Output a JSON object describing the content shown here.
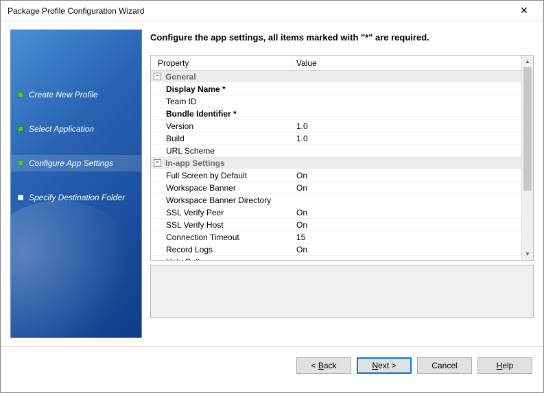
{
  "window": {
    "title": "Package Profile Configuration Wizard"
  },
  "sidebar": {
    "items": [
      {
        "label": "Create New Profile",
        "state": "done"
      },
      {
        "label": "Select Application",
        "state": "done"
      },
      {
        "label": "Configure App Settings",
        "state": "current"
      },
      {
        "label": "Specify Destination Folder",
        "state": "pending"
      }
    ]
  },
  "main": {
    "instruction": "Configure the app settings, all items marked with \"*\" are required.",
    "columns": {
      "property": "Property",
      "value": "Value"
    },
    "groups": [
      {
        "name": "General",
        "rows": [
          {
            "label": "Display Name *",
            "value": "",
            "required": true
          },
          {
            "label": "Team ID",
            "value": ""
          },
          {
            "label": "Bundle Identifier *",
            "value": "",
            "required": true
          },
          {
            "label": "Version",
            "value": "1.0"
          },
          {
            "label": "Build",
            "value": "1.0"
          },
          {
            "label": "URL Scheme",
            "value": ""
          }
        ]
      },
      {
        "name": "In-app Settings",
        "rows": [
          {
            "label": "Full Screen by Default",
            "value": "On"
          },
          {
            "label": "Workspace Banner",
            "value": "On"
          },
          {
            "label": "Workspace Banner Directory",
            "value": ""
          },
          {
            "label": "SSL Verify Peer",
            "value": "On"
          },
          {
            "label": "SSL Verify Host",
            "value": "On"
          },
          {
            "label": "Connection Timeout",
            "value": "15"
          },
          {
            "label": "Record Logs",
            "value": "On"
          },
          {
            "label": "Help Path",
            "value": ""
          }
        ]
      }
    ]
  },
  "footer": {
    "back": "ack",
    "back_prefix": "< ",
    "back_u": "B",
    "next": "ext >",
    "next_u": "N",
    "cancel": "Cancel",
    "help": "elp",
    "help_u": "H"
  }
}
